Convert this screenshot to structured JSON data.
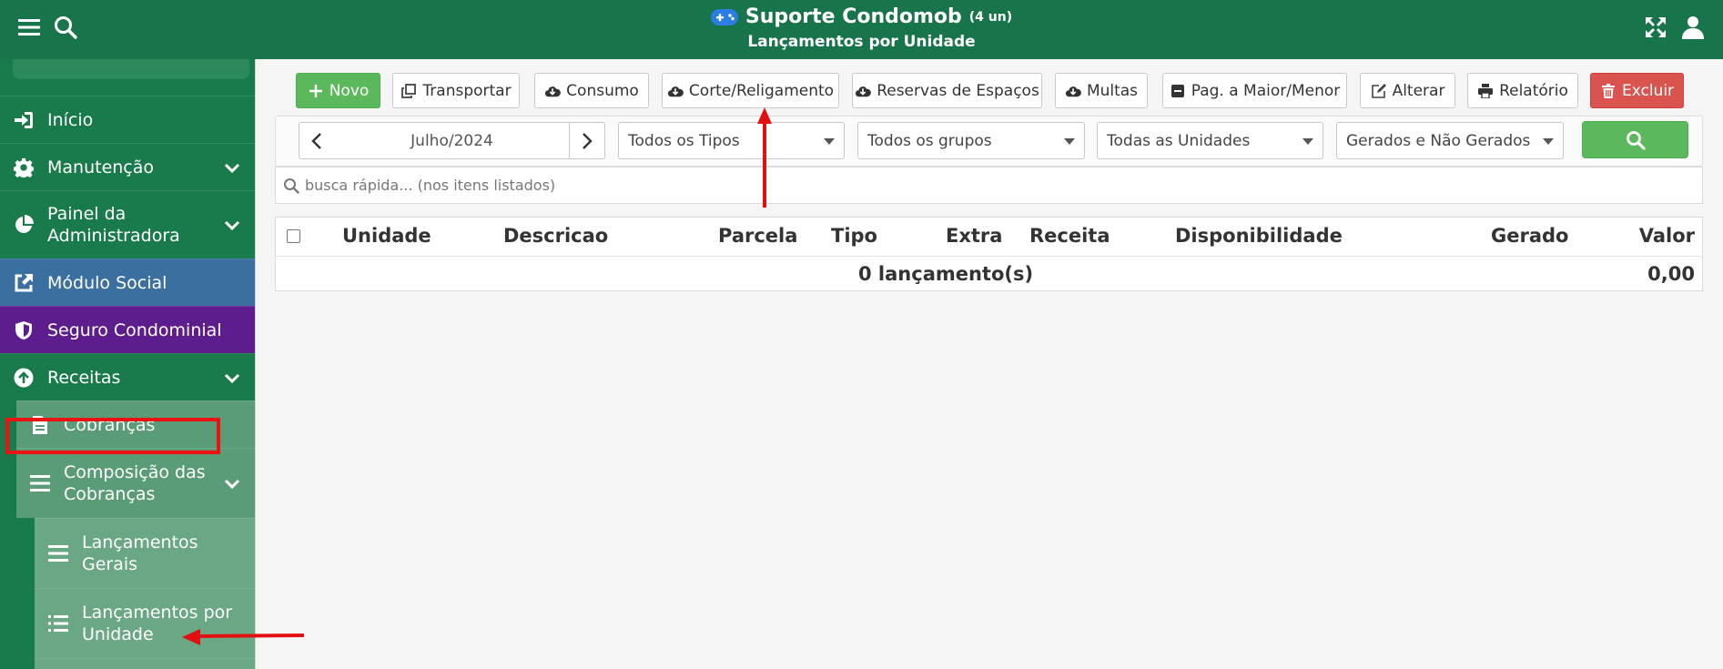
{
  "header": {
    "title": "Suporte Condomob",
    "units": "(4 un)",
    "subtitle": "Lançamentos por Unidade"
  },
  "sidebar": {
    "items": [
      {
        "label": "Início",
        "icon": "sign-in-icon"
      },
      {
        "label": "Manutenção",
        "icon": "gear-icon"
      },
      {
        "label": "Painel da Administradora",
        "icon": "pie-chart-icon"
      },
      {
        "label": "Módulo Social",
        "icon": "external-link-icon"
      },
      {
        "label": "Seguro Condominial",
        "icon": "shield-icon"
      },
      {
        "label": "Receitas",
        "icon": "arrow-up-circle-icon"
      },
      {
        "label": "Cobranças",
        "icon": "file-icon"
      },
      {
        "label": "Composição das Cobranças",
        "icon": "bars-icon"
      },
      {
        "label": "Lançamentos Gerais",
        "icon": "bars-icon"
      },
      {
        "label": "Lançamentos por Unidade",
        "icon": "list-icon"
      }
    ]
  },
  "toolbar": {
    "novo": "Novo",
    "transportar": "Transportar",
    "consumo": "Consumo",
    "corte": "Corte/Religamento",
    "reservas": "Reservas de Espaços",
    "multas": "Multas",
    "pag": "Pag. a Maior/Menor",
    "alterar": "Alterar",
    "relatorio": "Relatório",
    "excluir": "Excluir"
  },
  "filters": {
    "period": "Julho/2024",
    "tipos": "Todos os Tipos",
    "grupos": "Todos os grupos",
    "unidades": "Todas as Unidades",
    "gerados": "Gerados e Não Gerados"
  },
  "search": {
    "placeholder": "busca rápida... (nos itens listados)"
  },
  "table": {
    "columns": [
      "Unidade",
      "Descricao",
      "Parcela",
      "Tipo",
      "Extra",
      "Receita",
      "Disponibilidade",
      "Gerado",
      "Valor"
    ],
    "footer_count": "0 lançamento(s)",
    "footer_total": "0,00"
  },
  "colors": {
    "primary": "#18744b",
    "sidebar": "#197a4c",
    "social": "#3b6fa0",
    "seguro": "#5e1d8c",
    "green_button": "#5cb85c",
    "red_button": "#d9534f",
    "annotation": "#e11111"
  }
}
